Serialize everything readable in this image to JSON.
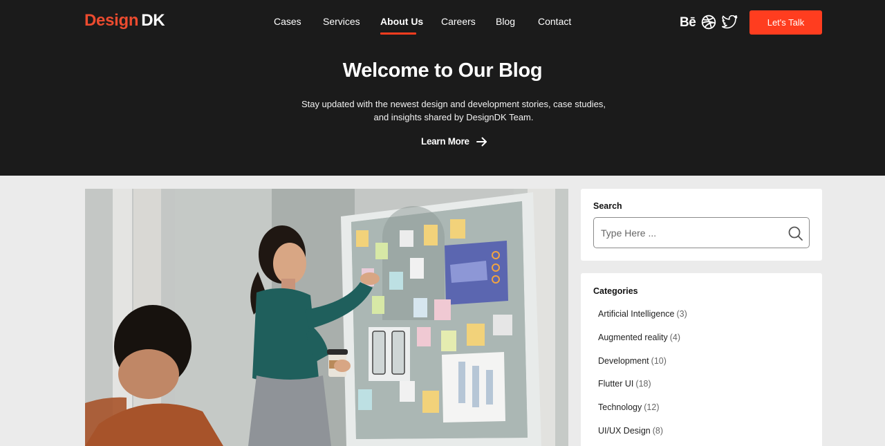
{
  "brand": {
    "part1": "Design",
    "part2": "DK"
  },
  "nav": {
    "items": [
      {
        "label": "Cases"
      },
      {
        "label": "Services"
      },
      {
        "label": "About Us",
        "active": true
      },
      {
        "label": "Careers"
      },
      {
        "label": "Blog"
      },
      {
        "label": "Contact"
      }
    ]
  },
  "social": {
    "behance": "Bē",
    "icons": [
      "behance-icon",
      "dribbble-icon",
      "twitter-icon"
    ]
  },
  "cta": {
    "label": "Let's Talk"
  },
  "hero": {
    "title": "Welcome to Our Blog",
    "subtitle_line1": "Stay updated with the newest design and development stories, case studies,",
    "subtitle_line2": "and insights shared by DesignDK Team.",
    "link_label": "Learn More"
  },
  "sidebar": {
    "search": {
      "title": "Search",
      "placeholder": "Type Here ..."
    },
    "categories": {
      "title": "Categories",
      "items": [
        {
          "name": "Artificial Intelligence",
          "count": "(3)"
        },
        {
          "name": "Augmented reality",
          "count": "(4)"
        },
        {
          "name": "Development",
          "count": "(10)"
        },
        {
          "name": "Flutter UI",
          "count": "(18)"
        },
        {
          "name": "Technology",
          "count": "(12)"
        },
        {
          "name": "UI/UX Design",
          "count": "(8)"
        }
      ]
    }
  },
  "colors": {
    "accent": "#ff3d1f",
    "brand_red": "#ec4b2f",
    "hero_bg": "#1b1b1b",
    "page_bg": "#ebebeb"
  }
}
